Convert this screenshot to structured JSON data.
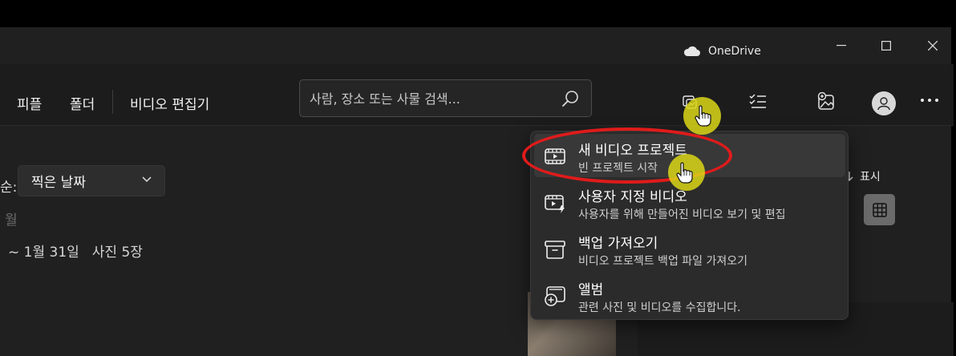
{
  "titlebar": {
    "onedrive_label": "OneDrive",
    "controls": [
      "minimize",
      "maximize",
      "close"
    ]
  },
  "nav": {
    "items": [
      "피플",
      "폴더",
      "비디오 편집기"
    ]
  },
  "search": {
    "placeholder": "사람, 장소 또는 사물 검색..."
  },
  "toolbar_icons": [
    "import-icon",
    "select-icon",
    "add-photo-icon",
    "avatar",
    "more-icon"
  ],
  "content": {
    "sort_label_fragment": "순:",
    "sort_value": "찍은 날짜",
    "month_fragment": "월",
    "date_range": "~ 1월 31일",
    "photo_count": "사진 5장",
    "view_label": "표시"
  },
  "menu": {
    "items": [
      {
        "title": "새 비디오 프로젝트",
        "subtitle": "빈 프로젝트 시작",
        "icon": "film-icon"
      },
      {
        "title": "사용자 지정 비디오",
        "subtitle": "사용자를 위해 만들어진 비디오 보기 및 편집",
        "icon": "auto-video-icon"
      },
      {
        "title": "백업 가져오기",
        "subtitle": "비디오 프로젝트 백업 파일 가져오기",
        "icon": "archive-icon"
      },
      {
        "title": "앨범",
        "subtitle": "관련 사진 및 비디오를 수집합니다.",
        "icon": "album-add-icon"
      }
    ]
  },
  "colors": {
    "window_bg": "#202020",
    "menu_bg": "#2b2b2b",
    "highlight_ring": "#e01b1b",
    "click_marker": "#dad618"
  }
}
